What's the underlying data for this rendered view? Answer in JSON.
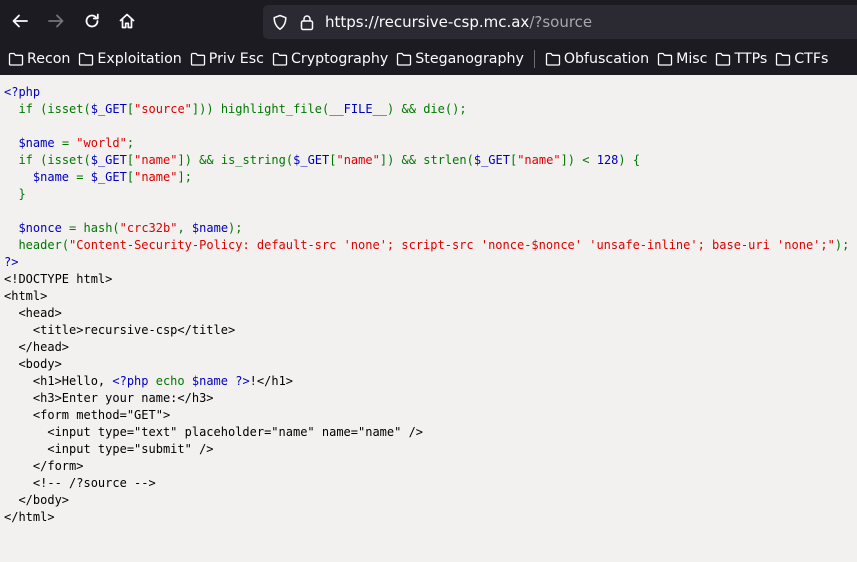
{
  "browser": {
    "url_host": "https://recursive-csp.mc.ax",
    "url_path": "/?source"
  },
  "bookmarks": [
    "Recon",
    "Exploitation",
    "Priv Esc",
    "Cryptography",
    "Steganography",
    "Obfuscation",
    "Misc",
    "TTPs",
    "CTFs"
  ],
  "source_lines": [
    "<?php",
    "  if (isset($_GET[\"source\"])) highlight_file(__FILE__) && die();",
    "",
    "  $name = \"world\";",
    "  if (isset($_GET[\"name\"]) && is_string($_GET[\"name\"]) && strlen($_GET[\"name\"]) < 128) {",
    "    $name = $_GET[\"name\"];",
    "  }",
    "",
    "  $nonce = hash(\"crc32b\", $name);",
    "  header(\"Content-Security-Policy: default-src 'none'; script-src 'nonce-$nonce' 'unsafe-inline'; base-uri 'none';\");",
    "?>",
    "<!DOCTYPE html>",
    "<html>",
    "  <head>",
    "    <title>recursive-csp</title>",
    "  </head>",
    "  <body>",
    "    <h1>Hello, <?php echo $name ?>!</h1>",
    "    <h3>Enter your name:</h3>",
    "    <form method=\"GET\">",
    "      <input type=\"text\" placeholder=\"name\" name=\"name\" />",
    "      <input type=\"submit\" />",
    "    </form>",
    "    <!-- /?source -->",
    "  </body>",
    "</html>"
  ],
  "colors": {
    "php_default": "#0000bb",
    "php_keyword": "#007700",
    "php_string": "#dd0000",
    "html": "#000000"
  }
}
